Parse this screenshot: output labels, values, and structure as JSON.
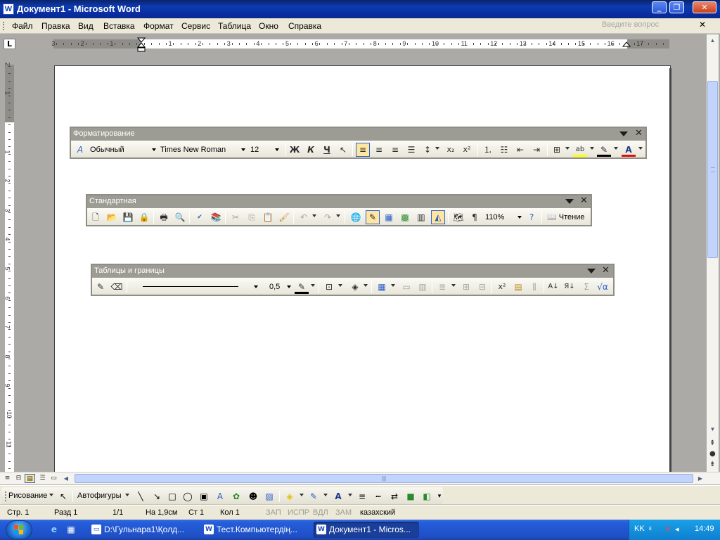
{
  "window": {
    "title": "Документ1 - Microsoft Word",
    "app_icon": "W"
  },
  "menu": [
    "Файл",
    "Правка",
    "Вид",
    "Вставка",
    "Формат",
    "Сервис",
    "Таблица",
    "Окно",
    "Справка"
  ],
  "question_box": {
    "placeholder": "Введите вопрос"
  },
  "ruler": {
    "h_numbers": [
      "3",
      "2",
      "1",
      "1",
      "2",
      "3",
      "4",
      "5",
      "6",
      "7",
      "8",
      "9",
      "10",
      "11",
      "12",
      "13",
      "14",
      "15",
      "16",
      "17"
    ],
    "v_numbers": [
      "2",
      "1",
      "1",
      "2",
      "3",
      "4",
      "5",
      "6",
      "7",
      "8",
      "9",
      "10",
      "11"
    ]
  },
  "toolbars": {
    "formatting": {
      "title": "Форматирование",
      "style": "Обычный",
      "font": "Times New Roman",
      "size": "12",
      "bold": "Ж",
      "italic": "К",
      "underline": "Ч"
    },
    "standard": {
      "title": "Стандартная",
      "zoom": "110%",
      "reading": "Чтение"
    },
    "tables": {
      "title": "Таблицы и границы",
      "line_weight": "0,5"
    }
  },
  "drawing": {
    "draw_label": "Рисование",
    "autoshapes_label": "Автофигуры"
  },
  "status": {
    "page": "Стр. 1",
    "section": "Разд 1",
    "pages": "1/1",
    "at": "На 1,9см",
    "line": "Ст 1",
    "col": "Кол 1",
    "rec": "ЗАП",
    "trk": "ИСПР",
    "ext": "ВДЛ",
    "ovr": "ЗАМ",
    "language": "казахский"
  },
  "taskbar": {
    "buttons": [
      {
        "label": "D:\\Гульнара1\\Қолд...",
        "icon": "folder-icon"
      },
      {
        "label": "Тест.Компьютердің...",
        "icon": "word-icon"
      },
      {
        "label": "Документ1 - Micros...",
        "icon": "word-icon"
      }
    ],
    "lang": "KK",
    "clock": "14:49"
  },
  "colors": {
    "title_bar": "#0c3bb1",
    "chrome": "#ece9d8",
    "taskbar": "#245ddb",
    "highlight": "#ffe6a0",
    "font_color": "#e01010",
    "highlight_color": "#ffff00"
  }
}
